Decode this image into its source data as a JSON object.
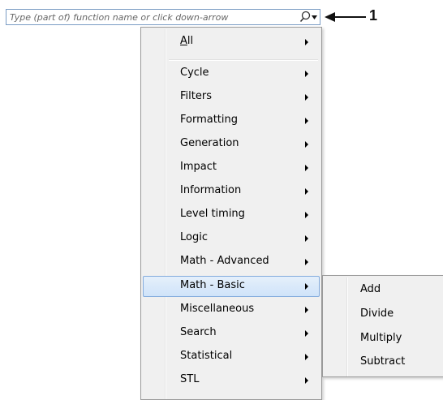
{
  "search": {
    "placeholder": "Type (part of) function name or click down-arrow",
    "search_icon": "magnifier-icon",
    "dropdown_icon": "chevron-down-icon"
  },
  "callout": {
    "label": "1"
  },
  "menu": {
    "items": [
      {
        "label": "All"
      },
      {
        "label": "Cycle"
      },
      {
        "label": "Filters"
      },
      {
        "label": "Formatting"
      },
      {
        "label": "Generation"
      },
      {
        "label": "Impact"
      },
      {
        "label": "Information"
      },
      {
        "label": "Level timing"
      },
      {
        "label": "Logic"
      },
      {
        "label": "Math - Advanced"
      },
      {
        "label": "Math - Basic",
        "highlighted": true
      },
      {
        "label": "Miscellaneous"
      },
      {
        "label": "Search"
      },
      {
        "label": "Statistical"
      },
      {
        "label": "STL"
      }
    ]
  },
  "submenu": {
    "items": [
      {
        "label": "Add"
      },
      {
        "label": "Divide"
      },
      {
        "label": "Multiply"
      },
      {
        "label": "Subtract"
      }
    ]
  },
  "colors": {
    "highlight_border": "#84acdd",
    "highlight_fill": "#d6e8fb",
    "menu_bg": "#f0f0f0"
  }
}
